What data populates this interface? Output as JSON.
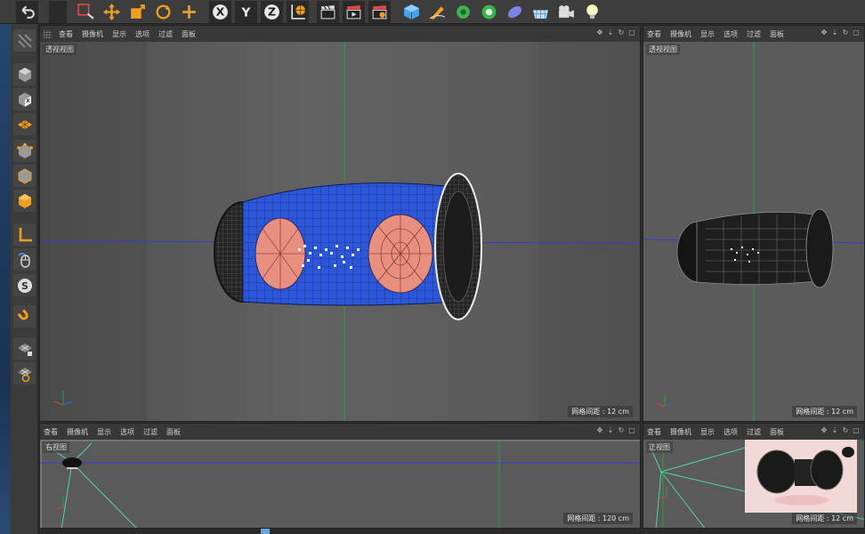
{
  "viewports": {
    "perspective_main": {
      "menu": [
        "查看",
        "摄像机",
        "显示",
        "选项",
        "过滤",
        "面板"
      ],
      "title": "透视视图",
      "grid": "网格间距 : 12 cm",
      "controls": [
        "✥",
        "⇣",
        "↻",
        "▢"
      ]
    },
    "perspective_side": {
      "menu": [
        "查看",
        "摄像机",
        "显示",
        "选项",
        "过滤",
        "面板"
      ],
      "title": "透视视图",
      "grid": "网格间距 : 12 cm",
      "controls": [
        "✥",
        "⇣",
        "↻",
        "▢"
      ]
    },
    "right_view": {
      "menu": [
        "查看",
        "摄像机",
        "显示",
        "选项",
        "过滤",
        "面板"
      ],
      "title": "右视图",
      "grid": "网格间距 : 120 cm",
      "controls": [
        "✥",
        "⇣",
        "↻",
        "▢"
      ]
    },
    "front_view": {
      "menu": [
        "查看",
        "摄像机",
        "显示",
        "选项",
        "过滤",
        "面板"
      ],
      "title": "正视图",
      "grid": "网格间距 : 12 cm",
      "controls": [
        "✥",
        "⇣",
        "↻",
        "▢"
      ]
    }
  },
  "toolbar": {
    "axis_labels": [
      "X",
      "Y",
      "Z"
    ]
  },
  "colors": {
    "model_blue": "#2b55d8",
    "model_pink": "#e98f80",
    "axis_green": "#2f9e3c",
    "axis_blue": "#3b3bd0",
    "accent_orange": "#f0a020"
  }
}
